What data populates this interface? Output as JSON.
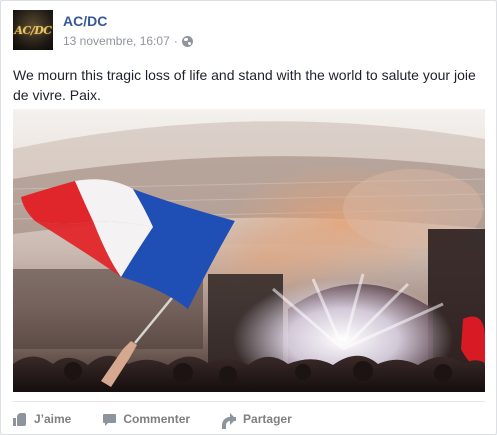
{
  "post": {
    "page_name": "AC/DC",
    "avatar_logo_text": "AC/DC",
    "timestamp": "13 novembre, 16:07",
    "separator": "·",
    "privacy_icon": "globe-icon",
    "message": "We mourn this tragic loss of life and stand with the world to salute your joie de vivre. Paix.",
    "photo_icon": "concert-photo-with-french-flag"
  },
  "actions": {
    "like_label": "J’aime",
    "comment_label": "Commenter",
    "share_label": "Partager"
  },
  "colors": {
    "link_blue": "#365899",
    "meta_gray": "#90949c",
    "action_gray": "#7f7f7f",
    "flag_blue": "#1f4fb5",
    "flag_red": "#e0262a"
  }
}
